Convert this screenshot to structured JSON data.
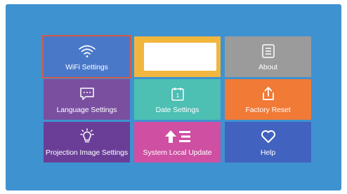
{
  "menu": {
    "wifi": {
      "label": "WiFi Settings",
      "icon": "wifi-icon"
    },
    "about": {
      "label": "About",
      "icon": "document-icon"
    },
    "language": {
      "label": "Language Settings",
      "icon": "chat-bubble-icon"
    },
    "date": {
      "label": "Date Settings",
      "icon": "calendar-icon"
    },
    "factory_reset": {
      "label": "Factory Reset",
      "icon": "upload-tray-icon"
    },
    "projection": {
      "label": "Projection Image Settings",
      "icon": "brightness-icon"
    },
    "system_update": {
      "label": "System Local Update",
      "icon": "upload-list-icon"
    },
    "help": {
      "label": "Help",
      "icon": "heart-icon"
    }
  },
  "calendar_day": "1",
  "colors": {
    "background": "#3f92d0",
    "wifi": "#4a78c9",
    "yellow": "#f2b63e",
    "about": "#9b9b9b",
    "language": "#7a4fa0",
    "date": "#4dbfb3",
    "factory_reset": "#f07a36",
    "projection": "#6a3e97",
    "system_update": "#cf4fa2",
    "help": "#4262bf",
    "selection": "#d35a47"
  }
}
